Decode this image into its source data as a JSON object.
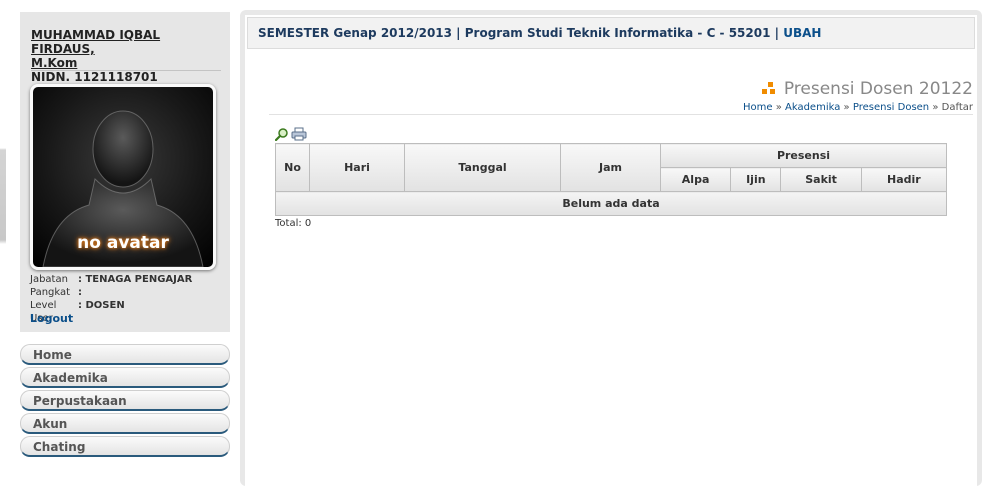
{
  "profile": {
    "name_line1": "MUHAMMAD IQBAL FIRDAUS,",
    "name_line2": "M.Kom",
    "nidn": "NIDN. 1121118701",
    "avatar_text": "no avatar",
    "jabatan_label": "Jabatan",
    "jabatan_value": ": TENAGA PENGAJAR",
    "pangkat_label": "Pangkat",
    "pangkat_value": ":",
    "level_label": "Level User",
    "level_value": ": DOSEN",
    "logout": "Logout"
  },
  "menu": {
    "items": [
      {
        "label": "Home"
      },
      {
        "label": "Akademika"
      },
      {
        "label": "Perpustakaan"
      },
      {
        "label": "Akun"
      },
      {
        "label": "Chating"
      }
    ]
  },
  "semester_bar": {
    "text": "SEMESTER Genap 2012/2013 | Program Studi Teknik Informatika - C - 55201 |",
    "ubah": "UBAH"
  },
  "page": {
    "title": "Presensi Dosen 20122",
    "breadcrumb": {
      "home": "Home",
      "sep": "»",
      "akademika": "Akademika",
      "presensi": "Presensi Dosen",
      "current": "Daftar"
    },
    "tools": {
      "search_icon": "magnifier-icon",
      "print_icon": "printer-icon"
    }
  },
  "table": {
    "headers": {
      "no": "No",
      "hari": "Hari",
      "tanggal": "Tanggal",
      "jam": "Jam",
      "presensi": "Presensi",
      "alpa": "Alpa",
      "ijin": "Ijin",
      "sakit": "Sakit",
      "hadir": "Hadir"
    },
    "empty_text": "Belum ada data",
    "total": "Total: 0"
  },
  "colors": {
    "accent": "#0b4f8a",
    "title_icon": "#f08c00",
    "menu_underline": "#2a5a7c"
  }
}
